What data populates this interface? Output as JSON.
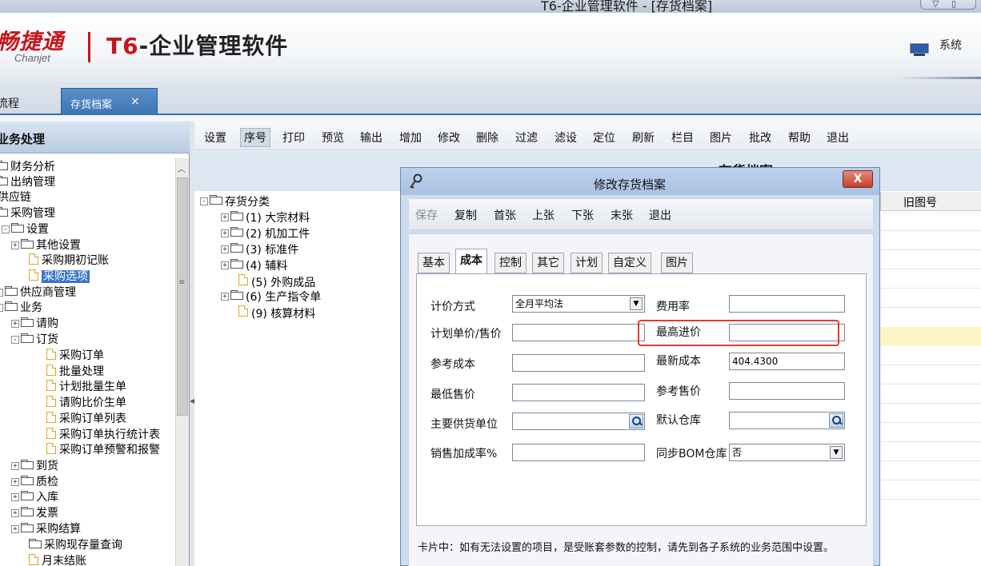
{
  "window": {
    "title": "T6-企业管理软件 - [存货档案]"
  },
  "header": {
    "logo_cn": "畅捷通",
    "logo_en": "Chanjet",
    "product_prefix": "T6",
    "product_rest": "-企业管理软件",
    "system_label": "系统"
  },
  "tabs": [
    {
      "label": "流程"
    },
    {
      "label": "存货档案",
      "close": "×"
    }
  ],
  "left_panel": {
    "title": "业务处理",
    "tree": [
      {
        "label": "财务分析"
      },
      {
        "label": "出纳管理"
      },
      {
        "label": "供应链"
      },
      {
        "label": "采购管理"
      },
      {
        "label": "设置"
      },
      {
        "label": "其他设置"
      },
      {
        "label": "采购期初记账"
      },
      {
        "label": "采购选项"
      },
      {
        "label": "供应商管理"
      },
      {
        "label": "业务"
      },
      {
        "label": "请购"
      },
      {
        "label": "订货"
      },
      {
        "label": "采购订单"
      },
      {
        "label": "批量处理"
      },
      {
        "label": "计划批量生单"
      },
      {
        "label": "请购比价生单"
      },
      {
        "label": "采购订单列表"
      },
      {
        "label": "采购订单执行统计表"
      },
      {
        "label": "采购订单预警和报警"
      },
      {
        "label": "到货"
      },
      {
        "label": "质检"
      },
      {
        "label": "入库"
      },
      {
        "label": "发票"
      },
      {
        "label": "采购结算"
      },
      {
        "label": "采购现存量查询"
      },
      {
        "label": "月末结账"
      }
    ]
  },
  "toolbar": {
    "items": [
      "设置",
      "序号",
      "打印",
      "预览",
      "输出",
      "增加",
      "修改",
      "删除",
      "过滤",
      "滤设",
      "定位",
      "刷新",
      "栏目",
      "图片",
      "批改",
      "帮助",
      "退出"
    ]
  },
  "main": {
    "title": "存货档案",
    "category_tree": [
      {
        "label": "存货分类"
      },
      {
        "label": "(1) 大宗材料"
      },
      {
        "label": "(2) 机加工件"
      },
      {
        "label": "(3) 标准件"
      },
      {
        "label": "(4) 辅料"
      },
      {
        "label": "(5) 外购成品"
      },
      {
        "label": "(6) 生产指令单"
      },
      {
        "label": "(9) 核算材料"
      }
    ],
    "grid_header": "旧图号"
  },
  "dialog": {
    "title": "修改存货档案",
    "close": "X",
    "toolbar": [
      "保存",
      "复制",
      "首张",
      "上张",
      "下张",
      "末张",
      "退出"
    ],
    "tabs": [
      "基本",
      "成本",
      "控制",
      "其它",
      "计划",
      "自定义",
      "图片"
    ],
    "fields": {
      "pricing_method": {
        "label": "计价方式",
        "value": "全月平均法"
      },
      "expense_rate": {
        "label": "费用率",
        "value": ""
      },
      "plan_price": {
        "label": "计划单价/售价",
        "value": ""
      },
      "max_purchase_price": {
        "label": "最高进价",
        "value": ""
      },
      "ref_cost": {
        "label": "参考成本",
        "value": ""
      },
      "latest_cost": {
        "label": "最新成本",
        "value": "404.4300"
      },
      "min_sale_price": {
        "label": "最低售价",
        "value": ""
      },
      "ref_sale_price": {
        "label": "参考售价",
        "value": ""
      },
      "main_supplier": {
        "label": "主要供货单位",
        "value": ""
      },
      "default_warehouse": {
        "label": "默认仓库",
        "value": ""
      },
      "sale_markup": {
        "label": "销售加成率%",
        "value": ""
      },
      "sync_bom": {
        "label": "同步BOM仓库",
        "value": "否"
      }
    },
    "footnote": "卡片中：如有无法设置的项目，是受账套参数的控制，请先到各子系统的业务范围中设置。"
  },
  "colors": {
    "brand_red": "#c4161c",
    "tab_blue": "#3d74b4",
    "highlight_red": "#e23b2b"
  }
}
